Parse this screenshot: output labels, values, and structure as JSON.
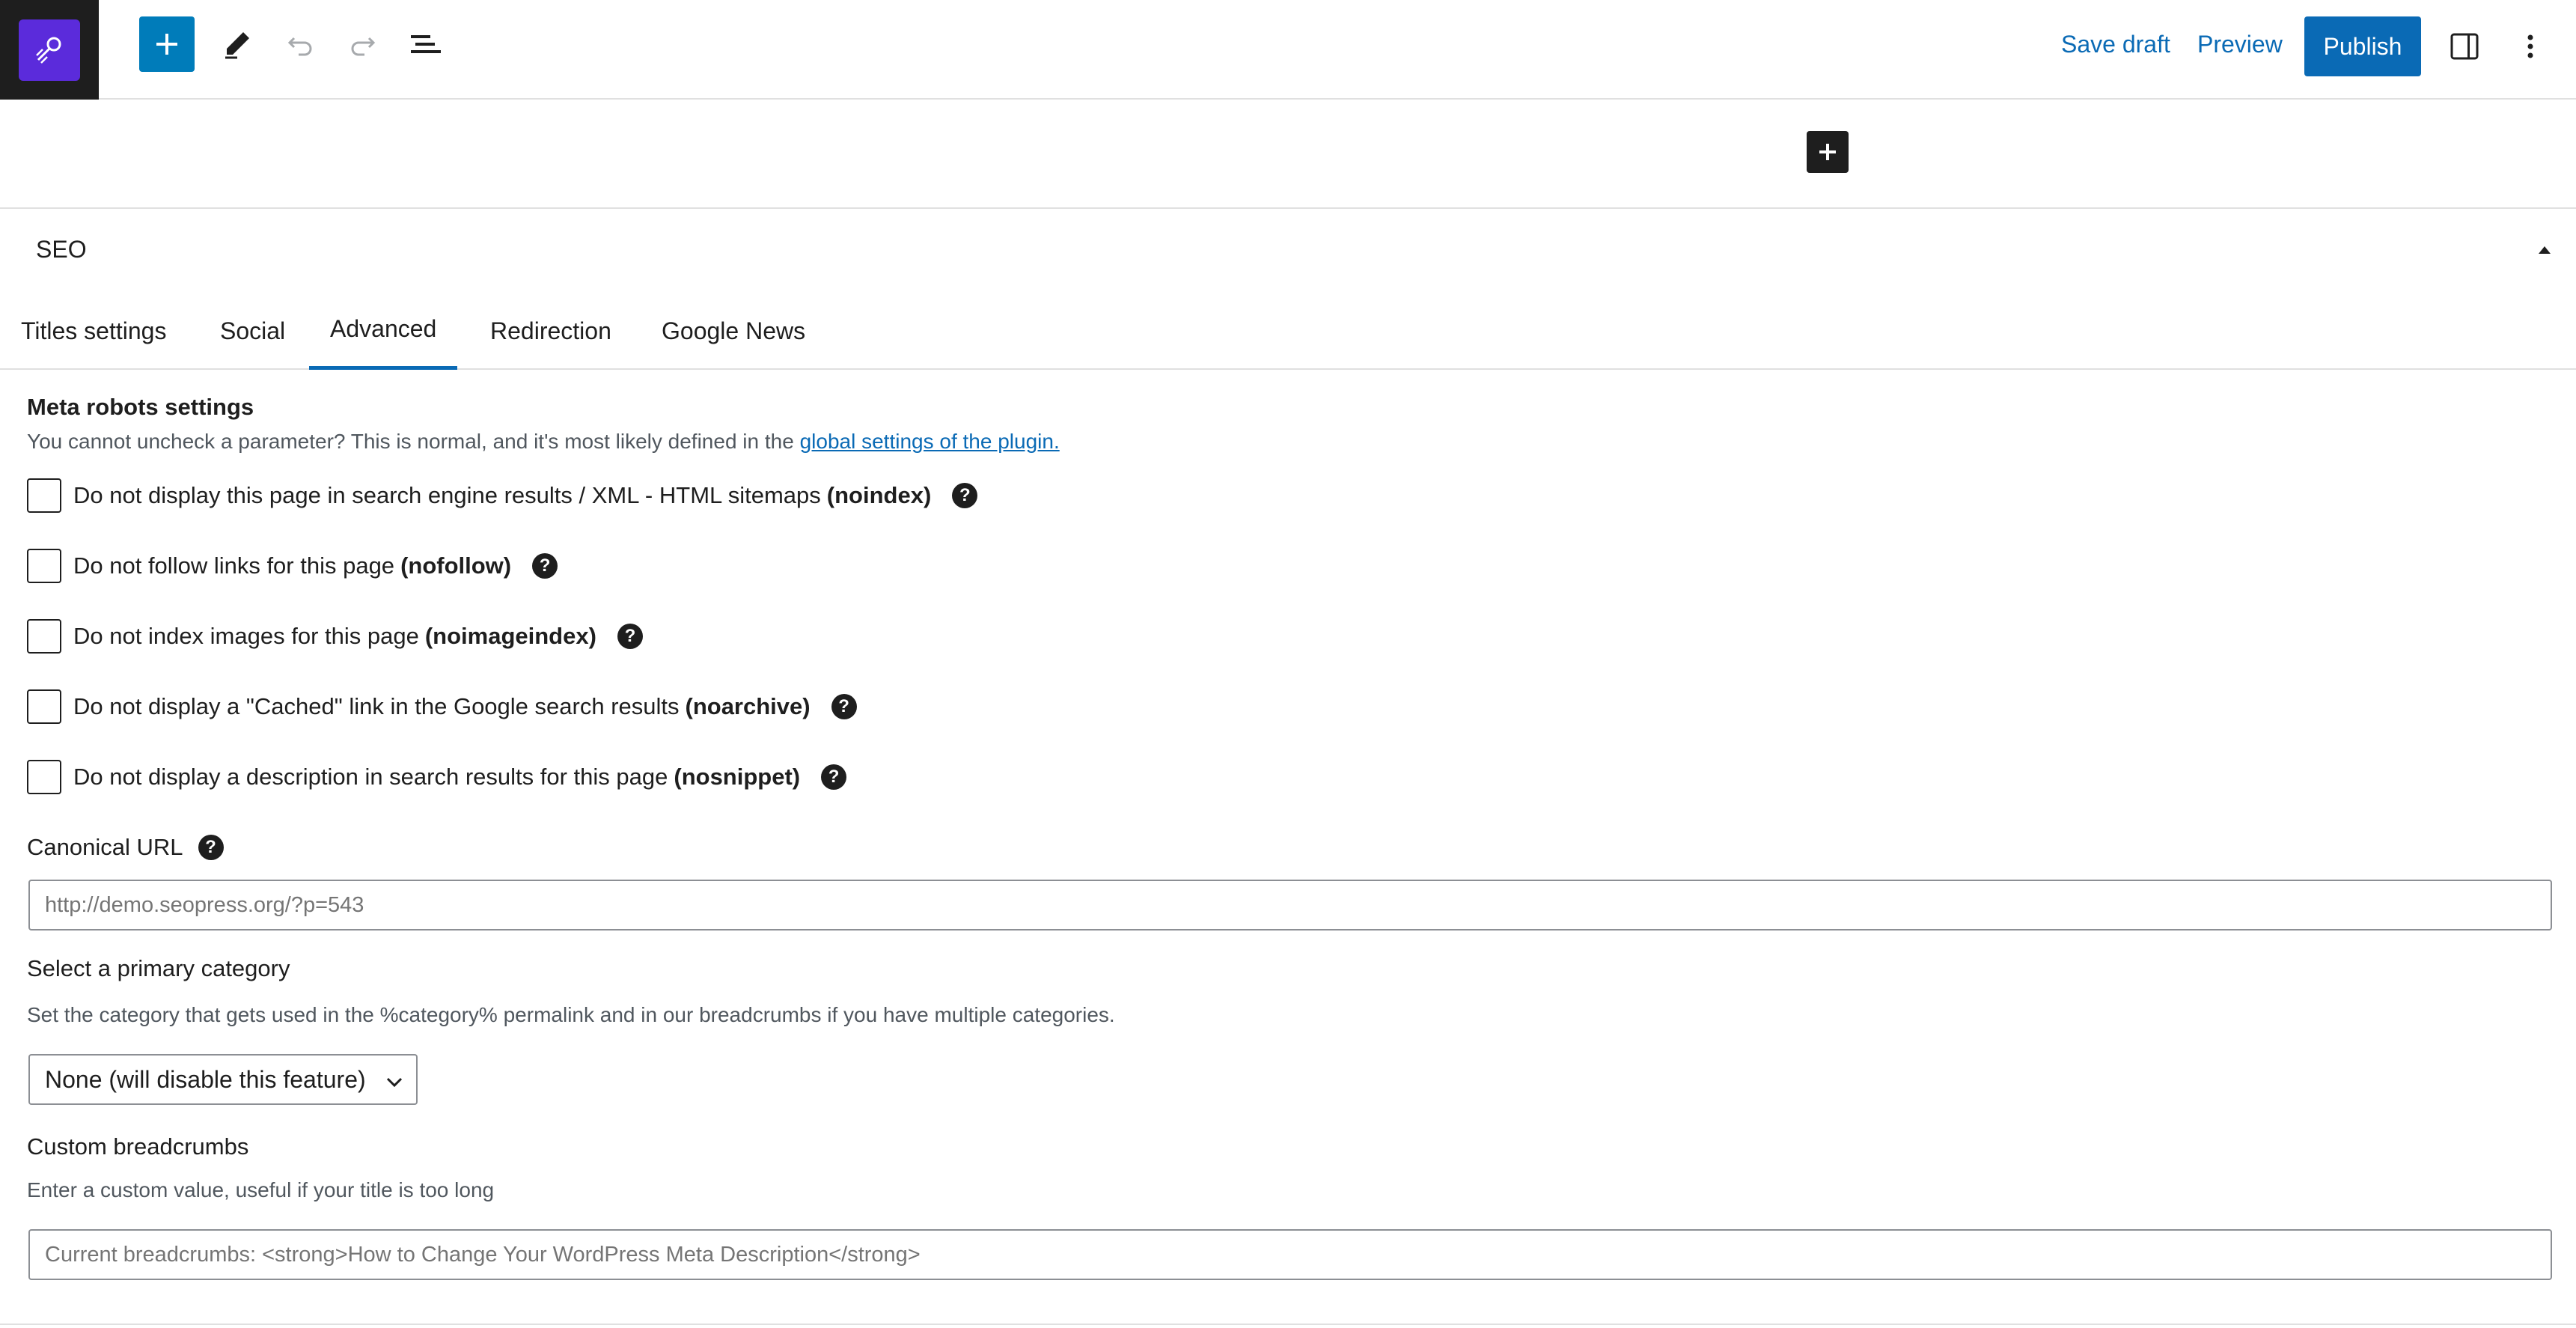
{
  "toolbar": {
    "save_draft": "Save draft",
    "preview": "Preview",
    "publish": "Publish",
    "accent_color": "#0a6ab5",
    "icons": [
      "add-block-icon",
      "edit-tool-icon",
      "undo-icon",
      "redo-icon",
      "document-overview-icon",
      "settings-sidebar-icon",
      "more-options-icon"
    ]
  },
  "seo_panel": {
    "title": "SEO",
    "tabs": [
      {
        "label": "Titles settings",
        "active": false
      },
      {
        "label": "Social",
        "active": false
      },
      {
        "label": "Advanced",
        "active": true
      },
      {
        "label": "Redirection",
        "active": false
      },
      {
        "label": "Google News",
        "active": false
      }
    ],
    "meta_robots": {
      "title": "Meta robots settings",
      "description": "You cannot uncheck a parameter? This is normal, and it's most likely defined in the",
      "link_text": "global settings of the plugin.",
      "options": [
        {
          "label": "Do not display this page in search engine results / XML - HTML sitemaps",
          "code": "(noindex)",
          "checked": false
        },
        {
          "label": "Do not follow links for this page",
          "code": "(nofollow)",
          "checked": false
        },
        {
          "label": "Do not index images for this page",
          "code": "(noimageindex)",
          "checked": false
        },
        {
          "label": "Do not display a \"Cached\" link in the Google search results",
          "code": "(noarchive)",
          "checked": false
        },
        {
          "label": "Do not display a description in search results for this page",
          "code": "(nosnippet)",
          "checked": false
        }
      ]
    },
    "canonical": {
      "label": "Canonical URL",
      "placeholder": "http://demo.seopress.org/?p=543"
    },
    "primary_category": {
      "label": "Select a primary category",
      "description": "Set the category that gets used in the %category% permalink and in our breadcrumbs if you have multiple categories.",
      "selected": "None (will disable this feature)"
    },
    "breadcrumbs": {
      "label": "Custom breadcrumbs",
      "description": "Enter a custom value, useful if your title is too long",
      "placeholder": "Current breadcrumbs: <strong>How to Change Your WordPress Meta Description</strong>"
    }
  }
}
